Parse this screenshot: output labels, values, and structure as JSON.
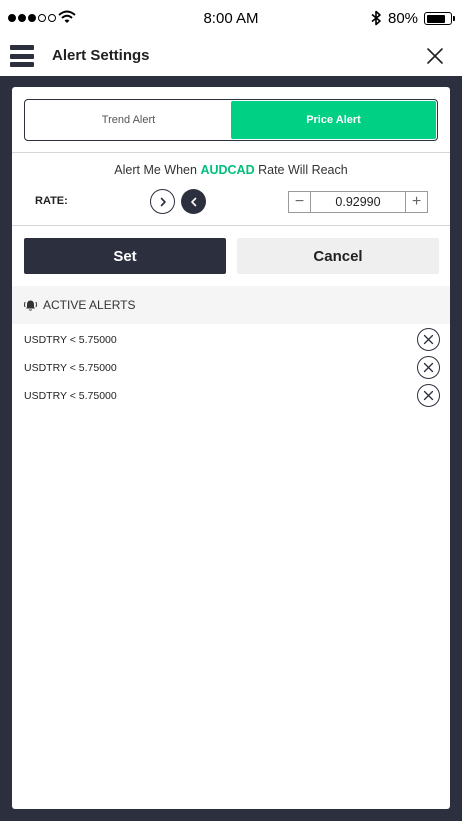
{
  "status_bar": {
    "time": "8:00 AM",
    "battery_percent": "80%",
    "battery_level": 0.8
  },
  "header": {
    "title": "Alert Settings"
  },
  "tabs": [
    {
      "label": "Trend Alert",
      "active": false
    },
    {
      "label": "Price Alert",
      "active": true
    }
  ],
  "alert_sentence": {
    "prefix": "Alert Me When",
    "pair": "AUDCAD",
    "suffix": "Rate Will Reach"
  },
  "rate": {
    "label": "RATE:",
    "value": "0.92990",
    "minus": "−",
    "plus": "+"
  },
  "buttons": {
    "set": "Set",
    "cancel": "Cancel"
  },
  "active_alerts": {
    "title": "ACTIVE ALERTS",
    "items": [
      {
        "label": "USDTRY < 5.75000"
      },
      {
        "label": "USDTRY < 5.75000"
      },
      {
        "label": "USDTRY < 5.75000"
      }
    ]
  },
  "colors": {
    "accent": "#00d084",
    "dark": "#2b2f3e"
  },
  "icons": [
    "signal-icon",
    "wifi-icon",
    "bluetooth-icon",
    "battery-icon",
    "hamburger-menu-icon",
    "close-icon",
    "chevron-right-icon",
    "chevron-left-icon",
    "bell-ringing-icon",
    "remove-circle-x-icon"
  ]
}
